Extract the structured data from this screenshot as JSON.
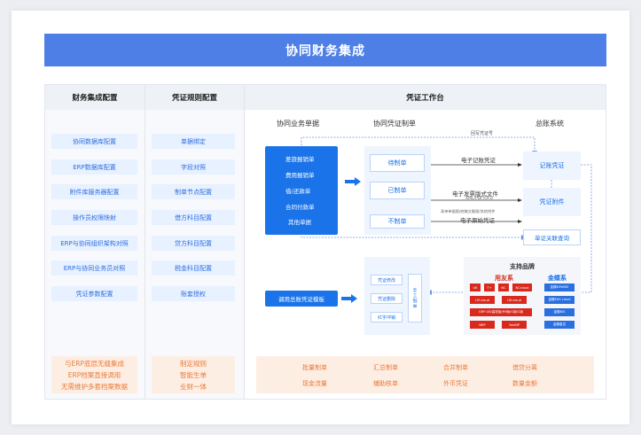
{
  "title": "协同财务集成",
  "columns": {
    "col1": "财务集成配置",
    "col2": "凭证规则配置",
    "col3": "凭证工作台"
  },
  "col1_items": [
    "协同数据库配置",
    "ERP数据库配置",
    "附件库服务器配置",
    "操作员权限映射",
    "ERP与协同组织架构对照",
    "ERP与协同业务员对照",
    "凭证参数配置"
  ],
  "col1_footer": [
    "与ERP底层无缝集成",
    "ERP档案直接调用",
    "无需维护多套档案数据"
  ],
  "col2_items": [
    "单据绑定",
    "字段对照",
    "制单节点配置",
    "借方科目配置",
    "贷方科目配置",
    "税金科目配置",
    "账套授权"
  ],
  "col2_footer": [
    "制定规则",
    "智能生单",
    "业财一体"
  ],
  "workbench": {
    "sub_titles": [
      "协同业务单据",
      "协同凭证制单",
      "总账系统"
    ],
    "business_docs": [
      "差旅报销单",
      "费用报销单",
      "借/还款单",
      "合同付款单",
      "其他单据"
    ],
    "voucher_states": [
      "待制单",
      "已制单",
      "不制单"
    ],
    "backwrite": "回写凭证号",
    "e_voucher": "电子记账凭证",
    "e_invoice": "电子发票版式文件",
    "e_invoice_fmt": "XML/PDF/OFD",
    "attach_note": "表单单据图/底稿文集图/其他附件",
    "original": "电子原始凭证",
    "gl": [
      "记账凭证",
      "凭证附件",
      "单证关联查询"
    ],
    "template_btn": "调用总账凭证模板",
    "tpl_ops": [
      "凭证修改",
      "凭证删除",
      "红字冲销"
    ],
    "manual": "手工制单",
    "brands_title": "支持品牌",
    "yonyou": "用友系",
    "kingdee": "金蝶系",
    "yonyou_brands": [
      "U8",
      "T+",
      "NC",
      "NCcloud",
      "U9 cloud",
      "U8 cloud",
      "GRP-U8/高校版/R9版/G版/C版",
      "NRP",
      "YonBIP"
    ],
    "kingdee_brands": [
      "金蝶K3WISE",
      "金蝶EAS cloud",
      "金蝶KIS",
      "金蝶星空"
    ],
    "footer": [
      "批量制单",
      "汇总制单",
      "合并制单",
      "借贷分离",
      "现金流量",
      "辅助核单",
      "外币凭证",
      "数量金额"
    ]
  },
  "colors": {
    "accent": "#4e7fe6",
    "primary": "#1a73e8",
    "peach": "#fdeee4",
    "orange": "#ea7a36",
    "red": "#d9291c"
  }
}
